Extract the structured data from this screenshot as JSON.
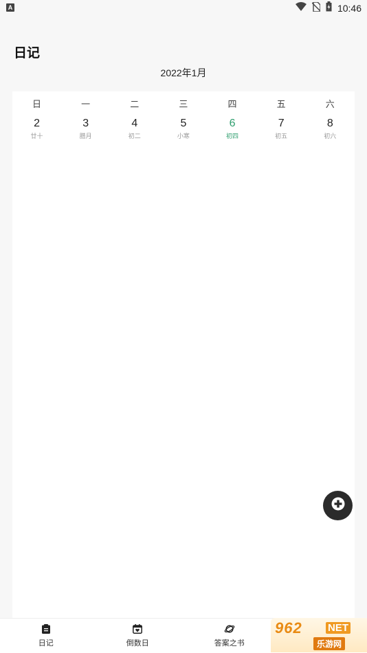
{
  "status_bar": {
    "left_icon": "A",
    "time": "10:46",
    "icons": [
      "wifi-icon",
      "no-sim-icon",
      "battery-icon"
    ]
  },
  "header": {
    "title": "日记"
  },
  "calendar": {
    "month_label": "2022年1月",
    "weekdays": [
      "日",
      "一",
      "二",
      "三",
      "四",
      "五",
      "六"
    ],
    "days": [
      {
        "day": "2",
        "lunar": "廿十",
        "today": false
      },
      {
        "day": "3",
        "lunar": "腊月",
        "today": false
      },
      {
        "day": "4",
        "lunar": "初二",
        "today": false
      },
      {
        "day": "5",
        "lunar": "小寒",
        "today": false
      },
      {
        "day": "6",
        "lunar": "初四",
        "today": true
      },
      {
        "day": "7",
        "lunar": "初五",
        "today": false
      },
      {
        "day": "8",
        "lunar": "初六",
        "today": false
      }
    ],
    "today_color": "#2e9e6e"
  },
  "fab": {
    "icon": "plus-icon",
    "color": "#2b2b2b"
  },
  "bottom_nav": {
    "items": [
      {
        "label": "日记",
        "icon": "diary-icon"
      },
      {
        "label": "倒数日",
        "icon": "countdown-calendar-icon"
      },
      {
        "label": "答案之书",
        "icon": "planet-icon"
      }
    ]
  },
  "watermark": {
    "top": "962",
    "net": "NET",
    "bottom": "乐游网"
  }
}
